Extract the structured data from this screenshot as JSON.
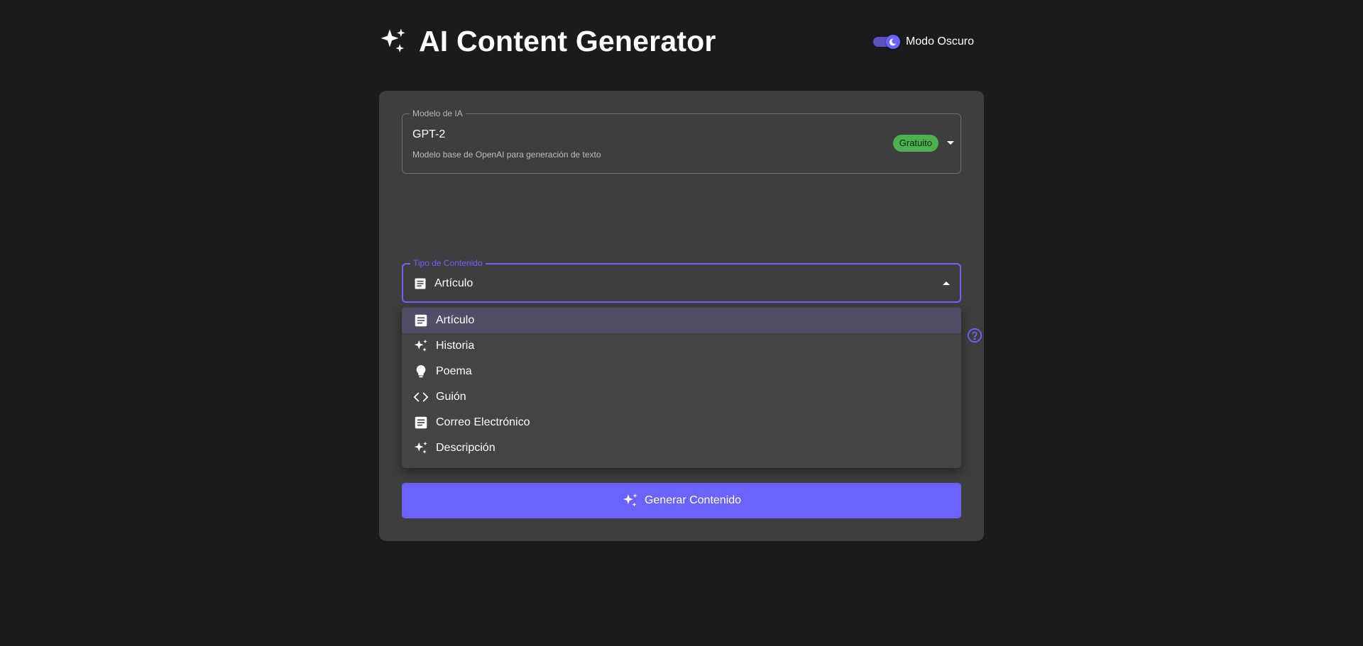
{
  "header": {
    "title": "AI Content Generator",
    "title_icon": "sparkles-icon",
    "dark_mode_label": "Modo Oscuro",
    "dark_mode_on": true
  },
  "model_select": {
    "legend": "Modelo de IA",
    "value": "GPT-2",
    "description": "Modelo base de OpenAI para generación de texto",
    "badge": "Gratuito",
    "badge_color": "#4caf50"
  },
  "content_type": {
    "legend": "Tipo de Contenido",
    "value": "Artículo",
    "value_icon": "article-icon",
    "options": [
      {
        "label": "Artículo",
        "icon": "article-icon",
        "selected": true
      },
      {
        "label": "Historia",
        "icon": "sparkles-icon",
        "selected": false
      },
      {
        "label": "Poema",
        "icon": "lightbulb-icon",
        "selected": false
      },
      {
        "label": "Guión",
        "icon": "code-icon",
        "selected": false
      },
      {
        "label": "Correo Electrónico",
        "icon": "article-icon",
        "selected": false
      },
      {
        "label": "Descripción",
        "icon": "sparkles-icon",
        "selected": false
      }
    ]
  },
  "help": {
    "icon": "help-circle-icon"
  },
  "generate_button": {
    "label": "Generar Contenido",
    "icon": "sparkles-icon"
  },
  "colors": {
    "background": "#1b1b1b",
    "card": "#3e3e3e",
    "accent": "#6c63ff",
    "badge": "#4caf50",
    "menu": "#444444",
    "menu_selected": "#4f4e66"
  }
}
